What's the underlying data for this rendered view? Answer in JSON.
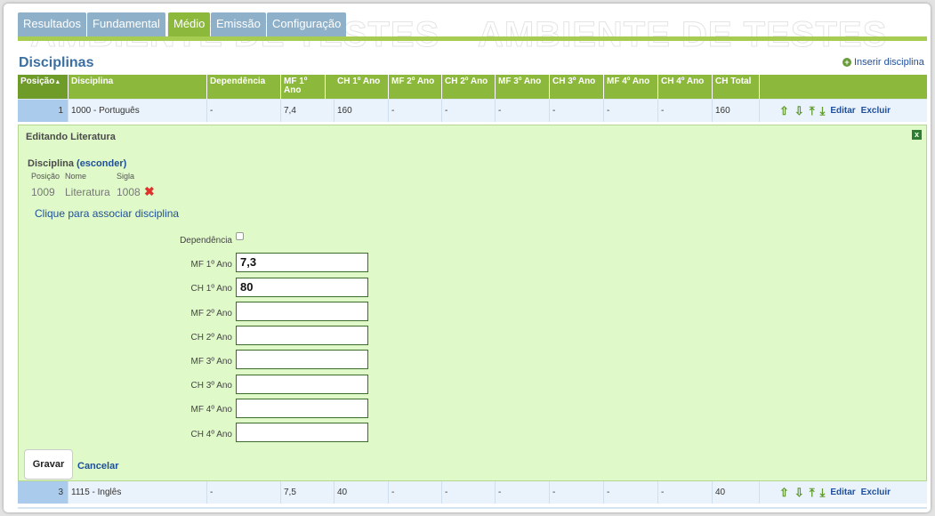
{
  "watermark": "AMBIENTE DE TESTES",
  "tabs": [
    {
      "label": "Resultados",
      "active": false
    },
    {
      "label": "Fundamental",
      "active": false
    },
    {
      "label": "Médio",
      "active": true
    },
    {
      "label": "Emissão",
      "active": false
    },
    {
      "label": "Configuração",
      "active": false
    }
  ],
  "page_title": "Disciplinas",
  "insert_link": "Inserir disciplina",
  "table": {
    "headers": {
      "posicao": "Posição",
      "disciplina": "Disciplina",
      "dependencia": "Dependência",
      "mf1": "MF 1º Ano",
      "ch1": "CH 1º Ano",
      "mf2": "MF 2º Ano",
      "ch2": "CH 2º Ano",
      "mf3": "MF 3º Ano",
      "ch3": "CH 3º Ano",
      "mf4": "MF 4º Ano",
      "ch4": "CH 4º Ano",
      "chtotal": "CH Total"
    },
    "sort_indicator": "▲",
    "rows": [
      {
        "pos": "1",
        "disciplina": "1000 - Português",
        "dep": "-",
        "mf1": "7,4",
        "ch1": "160",
        "mf2": "-",
        "ch2": "-",
        "mf3": "-",
        "ch3": "-",
        "mf4": "-",
        "ch4": "-",
        "chtotal": "160"
      },
      {
        "pos": "3",
        "disciplina": "1115 - Inglês",
        "dep": "-",
        "mf1": "7,5",
        "ch1": "40",
        "mf2": "-",
        "ch2": "-",
        "mf3": "-",
        "ch3": "-",
        "mf4": "-",
        "ch4": "-",
        "chtotal": "40"
      }
    ],
    "actions": {
      "edit": "Editar",
      "delete": "Excluir"
    }
  },
  "edit_panel": {
    "title": "Editando Literatura",
    "close_glyph": "x",
    "discipline_label": "Disciplina",
    "hide_link": "(esconder)",
    "cols": {
      "pos": "Posição",
      "name": "Nome",
      "sigla": "Sigla"
    },
    "values": {
      "pos": "1009",
      "name": "Literatura",
      "sigla": "1008"
    },
    "associate_link": "Clique para associar disciplina",
    "dependencia_label": "Dependência",
    "fields": [
      {
        "label": "MF 1º Ano",
        "value": "7,3"
      },
      {
        "label": "CH 1º Ano",
        "value": "80"
      },
      {
        "label": "MF 2º Ano",
        "value": ""
      },
      {
        "label": "CH 2º Ano",
        "value": ""
      },
      {
        "label": "MF 3º Ano",
        "value": ""
      },
      {
        "label": "CH 3º Ano",
        "value": ""
      },
      {
        "label": "MF 4º Ano",
        "value": ""
      },
      {
        "label": "CH 4º Ano",
        "value": ""
      }
    ],
    "save_label": "Gravar",
    "cancel_label": "Cancelar"
  },
  "colors": {
    "green": "#8cb83c",
    "tab_blue": "#8eb0c8",
    "link": "#1f4f9b",
    "panel_bg": "#dff9c9"
  }
}
